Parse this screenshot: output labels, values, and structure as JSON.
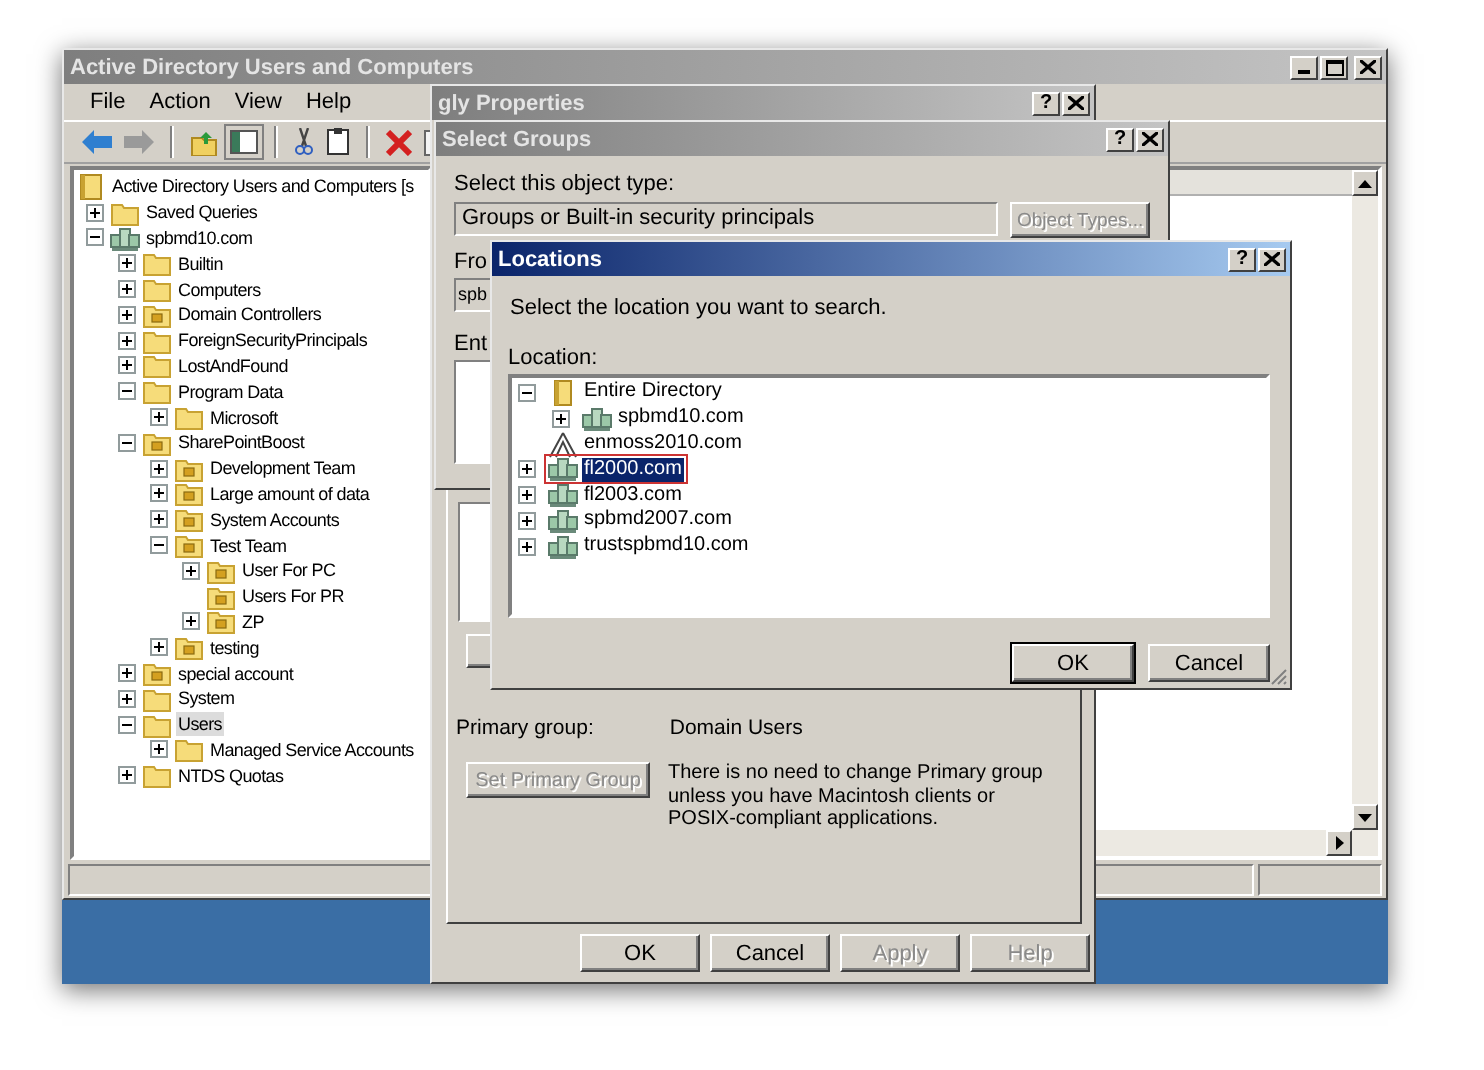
{
  "main_window": {
    "title": "Active Directory Users and Computers",
    "active": false,
    "menu": [
      "File",
      "Action",
      "View",
      "Help"
    ],
    "tree": [
      {
        "label": "Active Directory Users and Computers [s",
        "kind": "root",
        "selected": false,
        "children": [
          {
            "label": "Saved Queries",
            "kind": "folder",
            "expanded": false,
            "selected": false
          },
          {
            "label": "spbmd10.com",
            "kind": "domain",
            "expanded": true,
            "selected": false,
            "children": [
              {
                "label": "Builtin",
                "kind": "folder",
                "expanded": false,
                "selected": false
              },
              {
                "label": "Computers",
                "kind": "folder",
                "expanded": false,
                "selected": false
              },
              {
                "label": "Domain Controllers",
                "kind": "ou",
                "expanded": false,
                "selected": false
              },
              {
                "label": "ForeignSecurityPrincipals",
                "kind": "folder",
                "expanded": false,
                "selected": false
              },
              {
                "label": "LostAndFound",
                "kind": "folder",
                "expanded": false,
                "selected": false
              },
              {
                "label": "Program Data",
                "kind": "folder",
                "expanded": true,
                "selected": false,
                "children": [
                  {
                    "label": "Microsoft",
                    "kind": "folder",
                    "expanded": false,
                    "selected": false
                  }
                ]
              },
              {
                "label": "SharePointBoost",
                "kind": "ou",
                "expanded": true,
                "selected": false,
                "children": [
                  {
                    "label": "Development Team",
                    "kind": "ou",
                    "expanded": false,
                    "selected": false
                  },
                  {
                    "label": "Large amount of data",
                    "kind": "ou",
                    "expanded": false,
                    "selected": false
                  },
                  {
                    "label": "System Accounts",
                    "kind": "ou",
                    "expanded": false,
                    "selected": false
                  },
                  {
                    "label": "Test Team",
                    "kind": "ou",
                    "expanded": true,
                    "selected": false,
                    "children": [
                      {
                        "label": "User For PC",
                        "kind": "ou",
                        "expanded": false,
                        "selected": false
                      },
                      {
                        "label": "Users For PR",
                        "kind": "ou",
                        "selected": false
                      },
                      {
                        "label": "ZP",
                        "kind": "ou",
                        "expanded": false,
                        "selected": false
                      }
                    ]
                  },
                  {
                    "label": "testing",
                    "kind": "ou",
                    "expanded": false,
                    "selected": false
                  }
                ]
              },
              {
                "label": "special account",
                "kind": "ou",
                "expanded": false,
                "selected": false
              },
              {
                "label": "System",
                "kind": "folder",
                "expanded": false,
                "selected": false
              },
              {
                "label": "Users",
                "kind": "folder",
                "expanded": true,
                "selected": true,
                "children": [
                  {
                    "label": "Managed Service Accounts",
                    "kind": "folder",
                    "expanded": false,
                    "selected": false
                  }
                ]
              },
              {
                "label": "NTDS Quotas",
                "kind": "folder",
                "expanded": false,
                "selected": false
              }
            ]
          }
        ]
      }
    ]
  },
  "properties_dialog": {
    "title": "gly Properties",
    "active": false,
    "help": "?",
    "primary_group_label": "Primary group:",
    "primary_group_value": "Domain Users",
    "set_primary_group": {
      "label": "Set Primary Group",
      "disabled": true
    },
    "note": "There is no need to change Primary group unless you have Macintosh clients or POSIX-compliant applications.",
    "buttons": [
      {
        "label": "OK",
        "disabled": false
      },
      {
        "label": "Cancel",
        "disabled": false
      },
      {
        "label": "Apply",
        "disabled": true
      },
      {
        "label": "Help",
        "disabled": true
      }
    ]
  },
  "select_groups_dialog": {
    "title": "Select Groups",
    "active": false,
    "help": "?",
    "object_type_label": "Select this object type:",
    "object_type_value": "Groups or Built-in security principals",
    "object_types_button": {
      "label": "Object Types...",
      "disabled": true
    },
    "from_label": "Fro",
    "from_value": "spb",
    "entry_label": "Ent"
  },
  "locations_dialog": {
    "title": "Locations",
    "active": true,
    "help": "?",
    "prompt": "Select the location you want to search.",
    "location_label": "Location:",
    "tree": [
      {
        "label": "Entire Directory",
        "kind": "directory",
        "expanded": true,
        "selected": false,
        "children": [
          {
            "label": "spbmd10.com",
            "kind": "domain",
            "expanded": false,
            "selected": false
          }
        ]
      },
      {
        "label": "enmoss2010.com",
        "kind": "external",
        "selected": false
      },
      {
        "label": "fl2000.com",
        "kind": "domain",
        "expanded": false,
        "selected": true
      },
      {
        "label": "fl2003.com",
        "kind": "domain",
        "expanded": false,
        "selected": false
      },
      {
        "label": "spbmd2007.com",
        "kind": "domain",
        "expanded": false,
        "selected": false
      },
      {
        "label": "trustspbmd10.com",
        "kind": "domain",
        "expanded": false,
        "selected": false
      }
    ],
    "buttons": [
      {
        "label": "OK",
        "default": true
      },
      {
        "label": "Cancel",
        "default": false
      }
    ]
  }
}
